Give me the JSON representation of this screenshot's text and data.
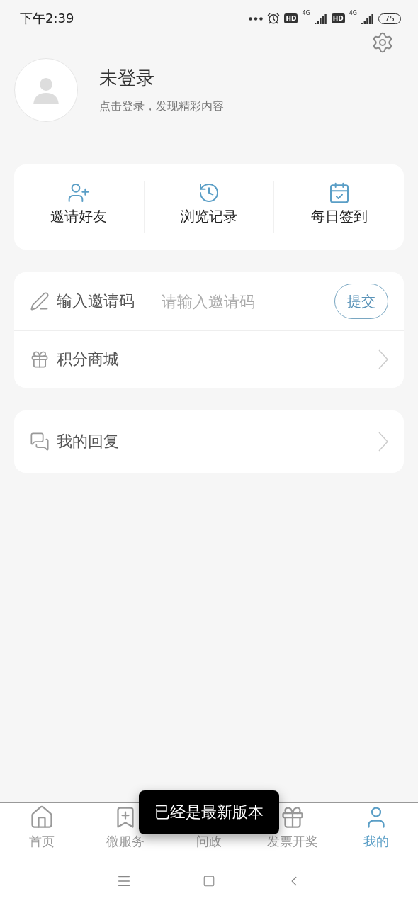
{
  "status_bar": {
    "time": "下午2:39",
    "sims": [
      {
        "hd": "HD",
        "network": "4G"
      },
      {
        "hd": "HD",
        "network": "4G"
      }
    ],
    "battery": "75"
  },
  "profile": {
    "name": "未登录",
    "hint": "点击登录，发现精彩内容"
  },
  "shortcuts": [
    {
      "label": "邀请好友"
    },
    {
      "label": "浏览记录"
    },
    {
      "label": "每日签到"
    }
  ],
  "invite": {
    "label": "输入邀请码",
    "placeholder": "请输入邀请码",
    "button": "提交"
  },
  "menu": [
    {
      "label": "积分商城"
    }
  ],
  "replies": {
    "label": "我的回复"
  },
  "tab_bar": [
    {
      "label": "首页",
      "selected": false
    },
    {
      "label": "微服务",
      "selected": false
    },
    {
      "label": "问政",
      "selected": false
    },
    {
      "label": "发票开奖",
      "selected": false
    },
    {
      "label": "我的",
      "selected": true
    }
  ],
  "toast": "已经是最新版本"
}
